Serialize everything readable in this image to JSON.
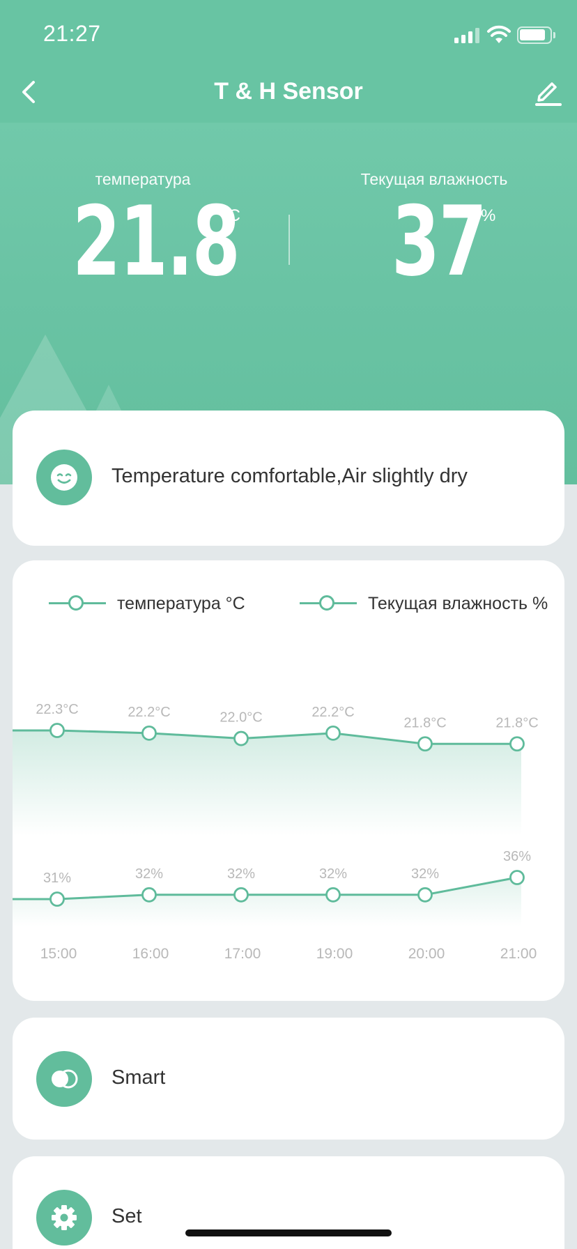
{
  "status_bar": {
    "time": "21:27"
  },
  "nav": {
    "title": "T & H Sensor"
  },
  "readings": {
    "temperature_label": "температура",
    "temperature_value": "21.8",
    "temperature_unit": "°C",
    "humidity_label": "Текущая влажность",
    "humidity_value": "37",
    "humidity_unit": "%"
  },
  "comfort": {
    "text": "Temperature comfortable,Air slightly dry",
    "icon": "smiley-face-icon"
  },
  "chart_data": {
    "type": "line",
    "x": [
      "15:00",
      "16:00",
      "17:00",
      "19:00",
      "20:00",
      "21:00"
    ],
    "series": [
      {
        "name": "температура °C",
        "values": [
          22.3,
          22.2,
          22.0,
          22.2,
          21.8,
          21.8
        ],
        "labels": [
          "22.3°C",
          "22.2°C",
          "22.0°C",
          "22.2°C",
          "21.8°C",
          "21.8°C"
        ],
        "color": "#5fbb9b"
      },
      {
        "name": "Текущая влажность %",
        "values": [
          31,
          32,
          32,
          32,
          32,
          36
        ],
        "labels": [
          "31%",
          "32%",
          "32%",
          "32%",
          "32%",
          "36%"
        ],
        "color": "#5fbb9b"
      }
    ],
    "legend_placement": "top-left",
    "grid": false
  },
  "menu": {
    "smart_label": "Smart",
    "smart_icon": "toggle-circles-icon",
    "set_label": "Set",
    "set_icon": "gear-icon"
  },
  "colors": {
    "accent": "#62bd9c",
    "header": "#6cc7a6",
    "line": "#5fbb9b",
    "label_gray": "#b8b8b8"
  }
}
